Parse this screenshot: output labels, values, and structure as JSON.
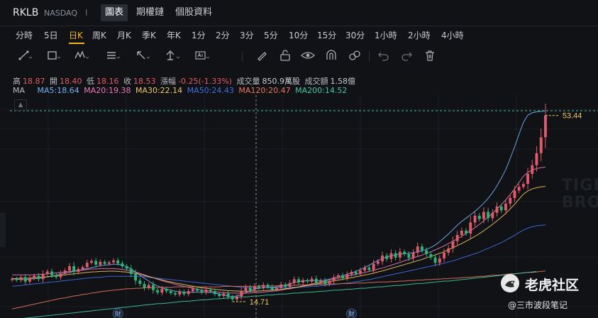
{
  "header": {
    "symbol": "RKLB",
    "exchange": "NASDAQ",
    "separator": "I",
    "tabs": [
      {
        "label": "圖表",
        "active": true
      },
      {
        "label": "期權鏈",
        "active": false
      },
      {
        "label": "個股資料",
        "active": false
      }
    ]
  },
  "timeframes": [
    "分時",
    "5日",
    "日K",
    "周K",
    "月K",
    "季K",
    "年K",
    "1分",
    "2分",
    "3分",
    "5分",
    "10分",
    "15分",
    "30分",
    "1小時",
    "2小時",
    "4小時"
  ],
  "timeframe_active": "日K",
  "tools": [
    "trend-line-icon",
    "rectangle-icon",
    "pattern-icon",
    "fib-icon",
    "arrow-icon",
    "measure-icon",
    "text-icon",
    "brush-icon",
    "lock-icon",
    "eye-icon",
    "magnet-icon",
    "link-icon",
    "undo-icon",
    "redo-icon",
    "trash-icon"
  ],
  "stats": {
    "high_label": "高",
    "high": "18.87",
    "open_label": "開",
    "open": "18.40",
    "low_label": "低",
    "low": "18.16",
    "close_label": "收",
    "close": "18.53",
    "change_label": "漲幅",
    "change": "-0.25(-1.33%)",
    "volume_label": "成交量",
    "volume": "850.9萬股",
    "turnover_label": "成交額",
    "turnover": "1.58億"
  },
  "ma": {
    "label": "MA",
    "items": [
      {
        "text": "MA5:18.64",
        "color": "#6fb4f5"
      },
      {
        "text": "MA20:19.38",
        "color": "#e879b8"
      },
      {
        "text": "MA30:22.14",
        "color": "#f0c75b"
      },
      {
        "text": "MA50:24.43",
        "color": "#3f6fe0"
      },
      {
        "text": "MA120:20.47",
        "color": "#e8765d"
      },
      {
        "text": "MA200:14.52",
        "color": "#3fc9a2"
      }
    ]
  },
  "chart_data": {
    "type": "candlestick",
    "y_range": [
      12.5,
      56.5
    ],
    "last_price": 53.44,
    "low_marker": 14.71,
    "event_badge": "財",
    "event_badge_indices": [
      24,
      77
    ],
    "colors": {
      "up": "#e05a67",
      "down": "#27b67a"
    },
    "closes": [
      19.5,
      19.2,
      19.8,
      18.9,
      19.6,
      20.1,
      19.4,
      20.5,
      21.0,
      20.2,
      19.8,
      20.6,
      21.2,
      22.1,
      20.9,
      21.5,
      21.9,
      22.8,
      23.2,
      22.4,
      23.0,
      22.6,
      22.9,
      23.3,
      22.7,
      22.1,
      21.6,
      20.5,
      19.1,
      18.4,
      17.6,
      18.2,
      17.1,
      16.6,
      17.4,
      16.9,
      16.5,
      16.2,
      16.8,
      16.3,
      16.9,
      17.4,
      17.0,
      16.6,
      17.2,
      16.9,
      16.3,
      15.9,
      16.4,
      15.7,
      15.2,
      15.8,
      16.9,
      17.7,
      17.1,
      17.9,
      17.5,
      18.2,
      17.8,
      17.2,
      17.6,
      18.3,
      17.8,
      18.6,
      19.4,
      18.7,
      19.2,
      18.9,
      19.5,
      18.6,
      19.1,
      18.4,
      19.0,
      19.8,
      20.2,
      19.6,
      20.4,
      20.9,
      20.5,
      21.2,
      21.8,
      21.3,
      22.6,
      23.1,
      24.3,
      23.6,
      24.8,
      23.9,
      25.1,
      24.6,
      23.8,
      24.9,
      26.2,
      25.4,
      24.6,
      23.9,
      22.8,
      23.7,
      24.9,
      25.8,
      27.3,
      28.6,
      29.5,
      28.9,
      31.2,
      32.6,
      31.9,
      33.4,
      32.1,
      33.2,
      34.5,
      33.7,
      35.1,
      36.3,
      37.8,
      38.6,
      39.2,
      41.3,
      43.1,
      45.6,
      48.9,
      53.44
    ],
    "ma_values": {
      "MA5": [
        19.5,
        19.4,
        19.3,
        19.3,
        19.4,
        19.5,
        19.6,
        19.7,
        19.9,
        20.0,
        20.2,
        20.4,
        20.6,
        20.8,
        21.0,
        21.2,
        21.4,
        21.6,
        21.8,
        22.0,
        22.2,
        22.3,
        22.4,
        22.5,
        22.5,
        22.3,
        22.0,
        21.5,
        20.9,
        20.2,
        19.6,
        19.0,
        18.4,
        18.0,
        17.6,
        17.3,
        17.1,
        16.9,
        16.8,
        16.7,
        16.7,
        16.7,
        16.7,
        16.7,
        16.7,
        16.6,
        16.5,
        16.3,
        16.1,
        15.9,
        15.8,
        15.9,
        16.2,
        16.6,
        17.0,
        17.3,
        17.5,
        17.6,
        17.7,
        17.7,
        17.8,
        17.9,
        18.1,
        18.4,
        18.7,
        18.9,
        19.0,
        19.1,
        19.1,
        19.1,
        19.1,
        19.2,
        19.4,
        19.7,
        19.9,
        20.1,
        20.4,
        20.7,
        21.0,
        21.4,
        21.8,
        22.3,
        22.8,
        23.3,
        23.7,
        24.0,
        24.3,
        24.5,
        24.6,
        24.7,
        24.8,
        24.9,
        25.1,
        25.3,
        25.6,
        26.0,
        26.5,
        27.2,
        28.0,
        28.8,
        29.7,
        30.6,
        31.4,
        32.1,
        32.8,
        33.5,
        34.3,
        35.2,
        36.2,
        37.4,
        38.8,
        40.4,
        42.2,
        44.5,
        46.9,
        49.5,
        52.0,
        53.5,
        54.0,
        54.2,
        54.3,
        54.4
      ],
      "MA20": [
        20.3,
        20.3,
        20.3,
        20.3,
        20.3,
        20.3,
        20.4,
        20.4,
        20.5,
        20.6,
        20.7,
        20.8,
        20.9,
        21.0,
        21.1,
        21.2,
        21.3,
        21.4,
        21.5,
        21.5,
        21.6,
        21.6,
        21.6,
        21.6,
        21.5,
        21.4,
        21.3,
        21.1,
        20.9,
        20.6,
        20.3,
        20.0,
        19.7,
        19.4,
        19.1,
        18.8,
        18.6,
        18.3,
        18.1,
        17.9,
        17.7,
        17.5,
        17.3,
        17.1,
        17.0,
        16.9,
        16.8,
        16.7,
        16.6,
        16.5,
        16.5,
        16.5,
        16.5,
        16.5,
        16.5,
        16.6,
        16.6,
        16.7,
        16.8,
        16.9,
        17.0,
        17.1,
        17.3,
        17.4,
        17.6,
        17.8,
        18.0,
        18.2,
        18.4,
        18.6,
        18.8,
        19.0,
        19.2,
        19.4,
        19.6,
        19.8,
        20.0,
        20.2,
        20.4,
        20.6,
        20.8,
        21.0,
        21.2,
        21.5,
        21.7,
        22.0,
        22.3,
        22.6,
        22.9,
        23.2,
        23.5,
        23.8,
        24.1,
        24.4,
        24.8,
        25.1,
        25.5,
        25.9,
        26.3,
        26.8,
        27.3,
        27.8,
        28.3,
        28.9,
        29.5,
        30.1,
        30.8,
        31.5,
        32.3,
        33.1,
        34.0,
        34.9,
        35.9,
        37.0,
        38.2,
        39.5,
        40.8,
        41.6,
        42.1,
        42.4,
        42.6,
        42.7
      ],
      "MA50": [
        17.9,
        18.0,
        18.1,
        18.2,
        18.3,
        18.4,
        18.5,
        18.6,
        18.7,
        18.8,
        18.9,
        19.0,
        19.1,
        19.2,
        19.3,
        19.4,
        19.5,
        19.6,
        19.7,
        19.8,
        19.8,
        19.9,
        20.0,
        20.0,
        20.0,
        20.0,
        20.0,
        20.0,
        20.0,
        19.9,
        19.9,
        19.8,
        19.7,
        19.6,
        19.5,
        19.4,
        19.3,
        19.2,
        19.1,
        19.0,
        18.9,
        18.8,
        18.7,
        18.6,
        18.5,
        18.4,
        18.3,
        18.2,
        18.1,
        18.0,
        17.9,
        17.8,
        17.7,
        17.7,
        17.6,
        17.6,
        17.6,
        17.6,
        17.6,
        17.6,
        17.6,
        17.6,
        17.6,
        17.7,
        17.7,
        17.7,
        17.8,
        17.8,
        17.9,
        17.9,
        18.0,
        18.1,
        18.2,
        18.3,
        18.4,
        18.5,
        18.6,
        18.7,
        18.9,
        19.0,
        19.2,
        19.3,
        19.5,
        19.7,
        19.9,
        20.1,
        20.3,
        20.5,
        20.7,
        20.9,
        21.1,
        21.3,
        21.5,
        21.7,
        21.9,
        22.1,
        22.3,
        22.5,
        22.7,
        23.0,
        23.2,
        23.5,
        23.8,
        24.1,
        24.4,
        24.7,
        25.0,
        25.4,
        25.8,
        26.2,
        26.6,
        27.0,
        27.5,
        28.0,
        28.5,
        29.1,
        29.6,
        30.0,
        30.3,
        30.5,
        30.6,
        30.7
      ],
      "MA120": [
        13.2,
        13.4,
        13.6,
        13.8,
        14.0,
        14.2,
        14.4,
        14.6,
        14.8,
        15.0,
        15.2,
        15.4,
        15.5,
        15.7,
        15.9,
        16.0,
        16.2,
        16.3,
        16.5,
        16.6,
        16.8,
        16.9,
        17.0,
        17.1,
        17.2,
        17.3,
        17.4,
        17.4,
        17.5,
        17.5,
        17.6,
        17.6,
        17.6,
        17.7,
        17.7,
        17.7,
        17.7,
        17.8,
        17.8,
        17.8,
        17.8,
        17.8,
        17.8,
        17.8,
        17.8,
        17.8,
        17.8,
        17.8,
        17.9,
        17.9,
        17.9,
        17.9,
        17.9,
        17.9,
        17.9,
        17.9,
        18.0,
        18.0,
        18.0,
        18.0,
        18.0,
        18.1,
        18.1,
        18.1,
        18.1,
        18.2,
        18.2,
        18.2,
        18.2,
        18.3,
        18.3,
        18.3,
        18.4,
        18.4,
        18.4,
        18.5,
        18.5,
        18.5,
        18.6,
        18.6,
        18.6,
        18.7,
        18.7,
        18.8,
        18.8,
        18.8,
        18.9,
        18.9,
        19.0,
        19.0,
        19.1,
        19.1,
        19.2,
        19.2,
        19.3,
        19.3,
        19.4,
        19.4,
        19.5,
        19.5,
        19.6,
        19.6,
        19.7,
        19.8,
        19.8,
        19.9,
        20.0,
        20.0,
        20.1,
        20.2,
        20.2,
        20.3,
        20.4,
        20.5,
        20.5,
        20.6,
        20.7,
        20.8,
        20.8,
        20.9,
        21.0,
        21.1
      ],
      "MA200": [
        11.0,
        11.1,
        11.2,
        11.3,
        11.4,
        11.5,
        11.6,
        11.7,
        11.8,
        11.9,
        12.0,
        12.1,
        12.2,
        12.3,
        12.4,
        12.5,
        12.6,
        12.7,
        12.8,
        12.9,
        13.0,
        13.1,
        13.2,
        13.3,
        13.4,
        13.5,
        13.6,
        13.7,
        13.8,
        13.9,
        14.0,
        14.1,
        14.2,
        14.3,
        14.3,
        14.4,
        14.5,
        14.6,
        14.7,
        14.8,
        14.8,
        14.9,
        15.0,
        15.1,
        15.1,
        15.2,
        15.3,
        15.3,
        15.4,
        15.5,
        15.5,
        15.6,
        15.7,
        15.7,
        15.8,
        15.9,
        15.9,
        16.0,
        16.1,
        16.1,
        16.2,
        16.3,
        16.3,
        16.4,
        16.5,
        16.5,
        16.6,
        16.7,
        16.7,
        16.8,
        16.9,
        16.9,
        17.0,
        17.1,
        17.1,
        17.2,
        17.3,
        17.3,
        17.4,
        17.5,
        17.5,
        17.6,
        17.7,
        17.8,
        17.8,
        17.9,
        18.0,
        18.1,
        18.1,
        18.2,
        18.3,
        18.4,
        18.5,
        18.5,
        18.6,
        18.7,
        18.8,
        18.9,
        19.0,
        19.0,
        19.1,
        19.2,
        19.3,
        19.4,
        19.5,
        19.6,
        19.7,
        19.8,
        19.9,
        20.0,
        20.1,
        20.2,
        20.3,
        20.4,
        20.5,
        20.6,
        20.7,
        20.8,
        20.9,
        21.0
      ]
    }
  },
  "watermark": {
    "line1": "TIGE",
    "line2": "BRO"
  },
  "brand": {
    "name": "老虎社区",
    "author": "@三市波段笔记"
  }
}
